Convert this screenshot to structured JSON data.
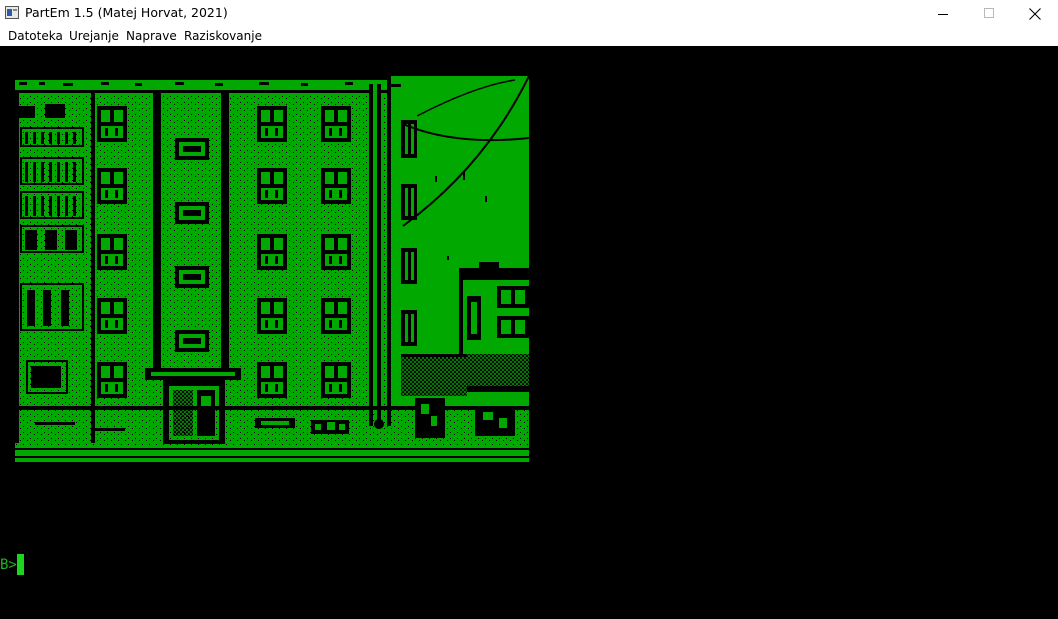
{
  "window": {
    "title": "PartEm 1.5 (Matej Horvat, 2021)"
  },
  "menu": {
    "items": [
      "Datoteka",
      "Urejanje",
      "Naprave",
      "Raziskovanje"
    ]
  },
  "console": {
    "prompt": "B>"
  },
  "colors": {
    "screen_background": "#000000",
    "phosphor_green": "#00a800",
    "titlebar": "#ffffff"
  },
  "icons": [
    "app-icon",
    "minimize-icon",
    "maximize-icon",
    "close-icon"
  ]
}
